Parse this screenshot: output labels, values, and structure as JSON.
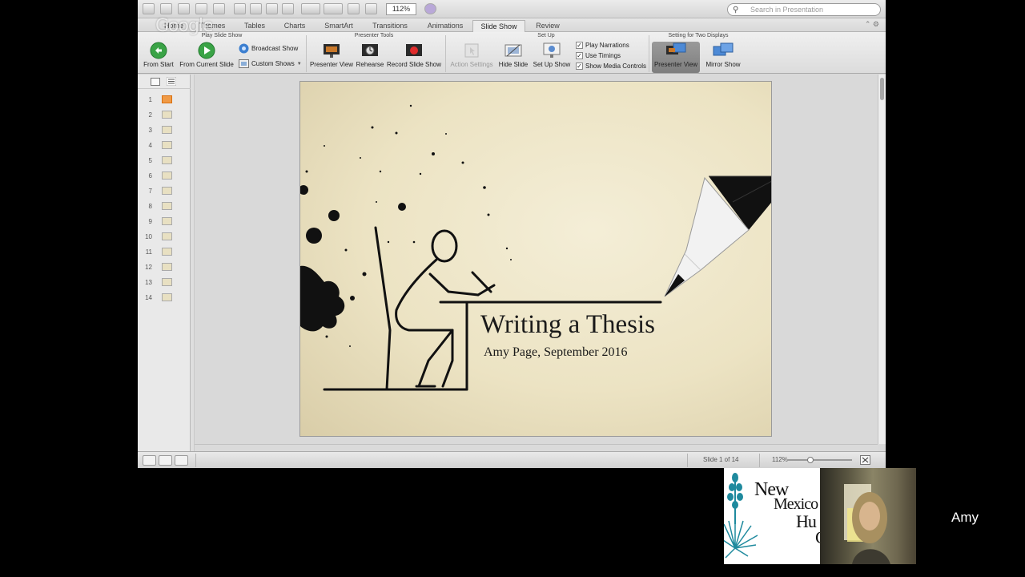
{
  "quick_access": {
    "zoom": "112%",
    "search_placeholder": "Search in Presentation"
  },
  "watermark": "Google",
  "ribbon_tabs": [
    "Home",
    "Themes",
    "Tables",
    "Charts",
    "SmartArt",
    "Transitions",
    "Animations",
    "Slide Show",
    "Review"
  ],
  "active_tab": "Slide Show",
  "groups": {
    "play": {
      "title": "Play Slide Show",
      "from_start": "From Start",
      "from_current": "From Current Slide",
      "broadcast": "Broadcast Show",
      "custom": "Custom Shows"
    },
    "presenter_tools": {
      "title": "Presenter Tools",
      "presenter_view": "Presenter View",
      "rehearse": "Rehearse",
      "record": "Record Slide Show"
    },
    "setup": {
      "title": "Set Up",
      "action_settings": "Action Settings",
      "hide_slide": "Hide Slide",
      "setup_show": "Set Up Show",
      "play_narrations": "Play Narrations",
      "use_timings": "Use Timings",
      "show_media_controls": "Show Media Controls"
    },
    "two_displays": {
      "title": "Setting for Two Displays",
      "presenter_view": "Presenter View",
      "mirror_show": "Mirror Show"
    }
  },
  "checkboxes": {
    "play_narrations": true,
    "use_timings": true,
    "show_media_controls": true
  },
  "slide_numbers": [
    "1",
    "2",
    "3",
    "4",
    "5",
    "6",
    "7",
    "8",
    "9",
    "10",
    "11",
    "12",
    "13",
    "14"
  ],
  "selected_slide": 1,
  "slide": {
    "title": "Writing a Thesis",
    "subtitle": "Amy Page, September 2016"
  },
  "status": {
    "slide_indicator": "Slide 1 of 14",
    "zoom": "112%"
  },
  "overlay": {
    "logo_line1": "New",
    "logo_line2": "Mexico",
    "logo_line3": "Hu",
    "logo_line4": "C",
    "participant_name": "Amy"
  },
  "colors": {
    "accent_active_thumb": "#f09a45",
    "logo_teal": "#1f8a9e",
    "slide_background": "#ece3c3"
  }
}
